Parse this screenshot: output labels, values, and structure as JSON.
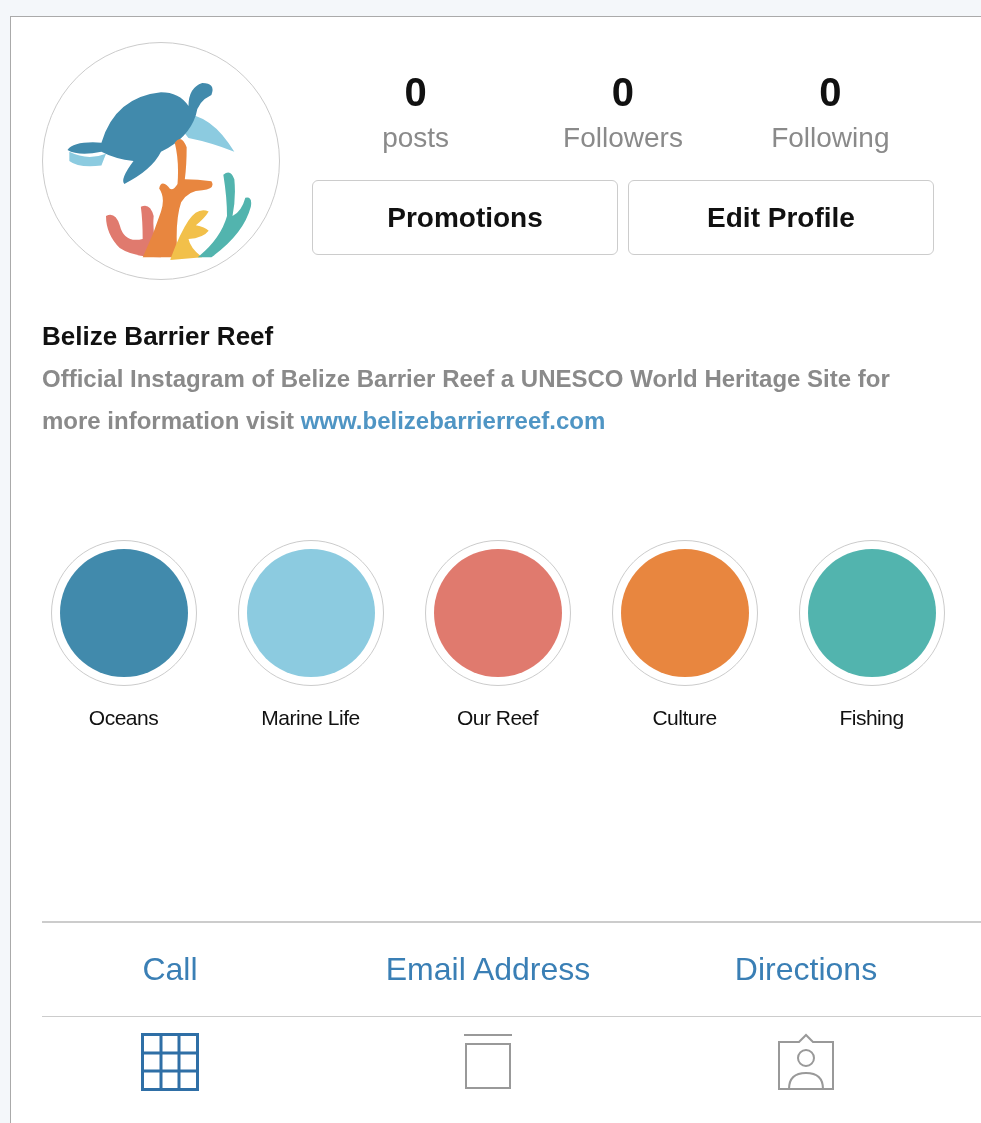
{
  "profile": {
    "stats": [
      {
        "count": "0",
        "label": "posts"
      },
      {
        "count": "0",
        "label": "Followers"
      },
      {
        "count": "0",
        "label": "Following"
      }
    ],
    "buttons": [
      "Promotions",
      "Edit Profile"
    ],
    "name": "Belize Barrier Reef",
    "bio": "Official Instagram of Belize Barrier Reef a UNESCO World Heritage Site for more information visit",
    "link": "www.belizebarrierreef.com"
  },
  "highlights": [
    {
      "label": "Oceans",
      "color": "#418aac"
    },
    {
      "label": "Marine Life",
      "color": "#8ccbe0"
    },
    {
      "label": "Our Reef",
      "color": "#e07a6e"
    },
    {
      "label": "Culture",
      "color": "#e8863f"
    },
    {
      "label": "Fishing",
      "color": "#52b4ae"
    }
  ],
  "contact": [
    "Call",
    "Email Address",
    "Directions"
  ],
  "tabs": [
    {
      "kind": "grid",
      "selected": true
    },
    {
      "kind": "feed",
      "selected": false
    },
    {
      "kind": "tagged",
      "selected": false
    }
  ]
}
